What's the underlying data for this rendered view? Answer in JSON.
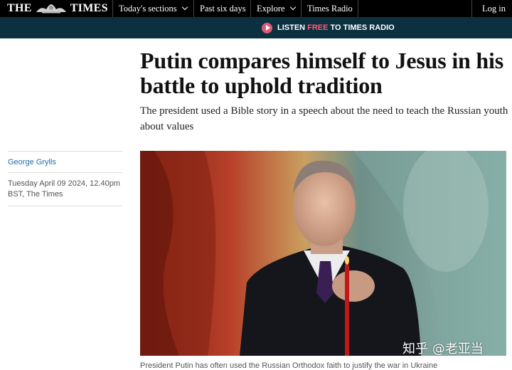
{
  "nav": {
    "logo_left": "THE",
    "logo_right": "TIMES",
    "items": [
      {
        "label": "Today's sections"
      },
      {
        "label": "Past six days"
      },
      {
        "label": "Explore"
      },
      {
        "label": "Times Radio"
      }
    ],
    "login": "Log in"
  },
  "radio_bar": {
    "pre": "LISTEN",
    "free": "FREE",
    "post": "TO TIMES RADIO",
    "icon": "play-icon",
    "background": "#0b3140",
    "accent": "#e05a78"
  },
  "article": {
    "headline": "Putin compares himself to Jesus in his battle to uphold tradition",
    "standfirst": "The president used a Bible story in a speech about the need to teach the Russian youth about values",
    "author": "George Grylls",
    "dateline": "Tuesday April 09 2024, 12.40pm BST, The Times",
    "caption": "President Putin has often used the Russian Orthodox faith to justify the war in Ukraine"
  },
  "watermark": "知乎 @老亚当"
}
